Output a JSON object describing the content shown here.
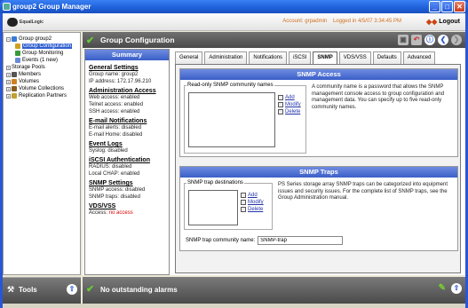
{
  "window": {
    "title": "group2 Group Manager",
    "minimize": "_",
    "maximize": "□",
    "close": "✕"
  },
  "header": {
    "brand": "EqualLogic",
    "account": "Account: grpadmin",
    "logged_in": "Logged in 4/5/07 3:34:45 PM",
    "logout": "Logout"
  },
  "tree": {
    "items": [
      {
        "label": "Group group2",
        "indent": 0,
        "expander": "−",
        "icon_color": "#3a7ad8",
        "selected": false
      },
      {
        "label": "Group Configuration",
        "indent": 1,
        "expander": "",
        "icon_color": "#d0a020",
        "selected": true
      },
      {
        "label": "Group Monitoring",
        "indent": 1,
        "expander": "",
        "icon_color": "#3a9a3a",
        "selected": false
      },
      {
        "label": "Events (1 new)",
        "indent": 1,
        "expander": "",
        "icon_color": "#6a8ad8",
        "selected": false
      },
      {
        "label": "Storage Pools",
        "indent": 0,
        "expander": "+",
        "icon_color": "",
        "selected": false
      },
      {
        "label": "Members",
        "indent": 0,
        "expander": "+",
        "icon_color": "#555",
        "selected": false
      },
      {
        "label": "Volumes",
        "indent": 0,
        "expander": "+",
        "icon_color": "#d08020",
        "selected": false
      },
      {
        "label": "Volume Collections",
        "indent": 0,
        "expander": "+",
        "icon_color": "#8a5a20",
        "selected": false
      },
      {
        "label": "Replication Partners",
        "indent": 0,
        "expander": "+",
        "icon_color": "#c0a030",
        "selected": false
      }
    ]
  },
  "tools": {
    "label": "Tools"
  },
  "main": {
    "title": "Group Configuration",
    "tabs": [
      "General",
      "Administration",
      "Notifications",
      "iSCSI",
      "SNMP",
      "VDS/VSS",
      "Defaults",
      "Advanced"
    ],
    "active_tab": "SNMP"
  },
  "summary": {
    "title": "Summary",
    "sections": [
      {
        "heading": "General Settings",
        "lines": [
          "Group name: group2",
          "IP address: 172.17.96.210"
        ]
      },
      {
        "heading": "Administration Access",
        "lines": [
          "Web access: enabled",
          "Telnet access: enabled",
          "SSH access: enabled"
        ]
      },
      {
        "heading": "E-mail Notifications",
        "lines": [
          "E-mail alerts: disabled",
          "E-mail Home: disabled"
        ]
      },
      {
        "heading": "Event Logs",
        "lines": [
          "Syslog: disabled"
        ]
      },
      {
        "heading": "iSCSI Authentication",
        "lines": [
          "RADIUS: disabled",
          "Local CHAP: enabled"
        ]
      },
      {
        "heading": "SNMP Settings",
        "lines": [
          "SNMP access: disabled",
          "SNMP traps: disabled"
        ]
      },
      {
        "heading": "VDS/VSS",
        "lines": [],
        "access_label": "Access: ",
        "access_value": "no access"
      }
    ]
  },
  "snmp_access": {
    "title": "SNMP Access",
    "legend": "Read-only SNMP community names",
    "add": "Add",
    "modify": "Modify",
    "delete": "Delete",
    "description": "A community name is a password that allows the SNMP management console access to group configuration and management data. You can specify up to five read-only community names."
  },
  "snmp_traps": {
    "title": "SNMP Traps",
    "legend": "SNMP trap destinations",
    "add": "Add",
    "modify": "Modify",
    "delete": "Delete",
    "description": "PS Series storage array SNMP traps can be categorized into equipment issues and security issues. For the complete list of SNMP traps, see the Group Administration manual.",
    "community_label": "SNMP trap community name:",
    "community_value": "SNMP-trap"
  },
  "status": {
    "message": "No outstanding alarms"
  },
  "colors": {
    "accent": "#3a5fc8",
    "alert_red": "#d00000",
    "ok_green": "#66cc33"
  }
}
